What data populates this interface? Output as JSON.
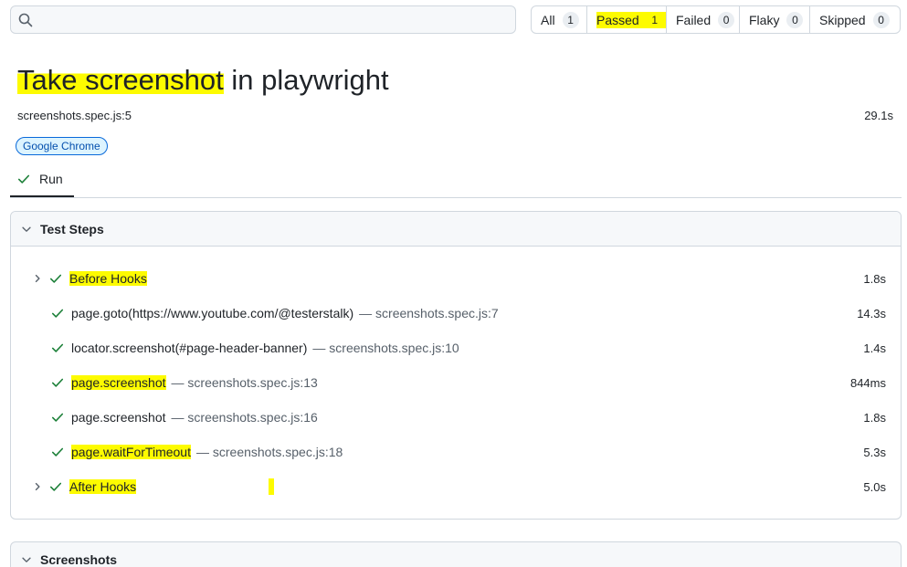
{
  "search": {
    "value": "",
    "placeholder": ""
  },
  "filters": [
    {
      "label": "All",
      "count": "1"
    },
    {
      "label": "Passed",
      "count": "1"
    },
    {
      "label": "Failed",
      "count": "0"
    },
    {
      "label": "Flaky",
      "count": "0"
    },
    {
      "label": "Skipped",
      "count": "0"
    }
  ],
  "test": {
    "title_part1": "Take screenshot",
    "title_part2": " in playwright",
    "file": "screenshots.spec.js:5",
    "duration": "29.1s",
    "project_badge": "Google Chrome"
  },
  "run_tab": {
    "label": "Run"
  },
  "steps_card": {
    "title": "Test Steps",
    "steps": [
      {
        "name": "Before Hooks",
        "loc": "",
        "duration": "1.8s",
        "expandable": true
      },
      {
        "name": "page.goto(https://www.youtube.com/@testerstalk)",
        "loc": "— screenshots.spec.js:7",
        "duration": "14.3s",
        "expandable": false
      },
      {
        "name": "locator.screenshot(#page-header-banner)",
        "loc": "— screenshots.spec.js:10",
        "duration": "1.4s",
        "expandable": false
      },
      {
        "name": "page.screenshot",
        "loc": "— screenshots.spec.js:13",
        "duration": "844ms",
        "expandable": false
      },
      {
        "name": "page.screenshot",
        "loc": "— screenshots.spec.js:16",
        "duration": "1.8s",
        "expandable": false
      },
      {
        "name": "page.waitForTimeout",
        "loc": "— screenshots.spec.js:18",
        "duration": "5.3s",
        "expandable": false
      },
      {
        "name": "After Hooks",
        "loc": "",
        "duration": "5.0s",
        "expandable": true
      }
    ]
  },
  "screenshots_card": {
    "title": "Screenshots"
  },
  "colors": {
    "check": "#1a7f37",
    "highlight": "#fdfb00",
    "badge_border": "#0969da"
  }
}
